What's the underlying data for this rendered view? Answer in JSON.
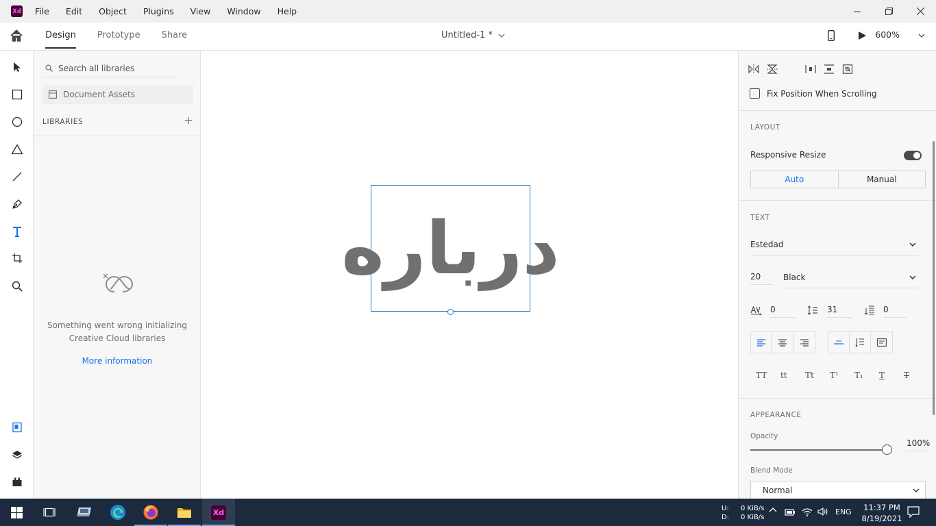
{
  "app": {
    "logo_text": "Xd",
    "menu": [
      "File",
      "Edit",
      "Object",
      "Plugins",
      "View",
      "Window",
      "Help"
    ]
  },
  "topbar": {
    "tabs": [
      "Design",
      "Prototype",
      "Share"
    ],
    "doc_title": "Untitled-1 *",
    "zoom": "600%"
  },
  "libraries": {
    "search_placeholder": "Search all libraries",
    "document_assets": "Document Assets",
    "header": "LIBRARIES",
    "error_text": "Something went wrong initializing Creative Cloud libraries",
    "more_info": "More information"
  },
  "canvas": {
    "text": "درباره"
  },
  "inspector": {
    "fix_position": "Fix Position When Scrolling",
    "layout": {
      "title": "LAYOUT",
      "responsive_resize": "Responsive Resize",
      "auto": "Auto",
      "manual": "Manual"
    },
    "text": {
      "title": "TEXT",
      "font_family": "Estedad",
      "font_size": "20",
      "font_weight": "Black",
      "char_spacing": "0",
      "line_spacing": "31",
      "para_spacing": "0",
      "case_buttons": [
        "TT",
        "tt",
        "Tt",
        "T¹",
        "T₁",
        "T",
        "T"
      ]
    },
    "appearance": {
      "title": "APPEARANCE",
      "opacity_label": "Opacity",
      "opacity_value": "100%",
      "opacity": 1.0,
      "blend_label": "Blend Mode",
      "blend_value": "Normal"
    }
  },
  "taskbar": {
    "net_upload_label": "U:",
    "net_download_label": "D:",
    "net_upload": "0 KiB/s",
    "net_download": "0 KiB/s",
    "language": "ENG",
    "time": "11:37 PM",
    "date": "8/19/2021"
  },
  "colors": {
    "accent": "#1473e6",
    "xd_brand": "#470137",
    "selection": "#1d7cc2",
    "taskbar": "#1c2a3d"
  }
}
